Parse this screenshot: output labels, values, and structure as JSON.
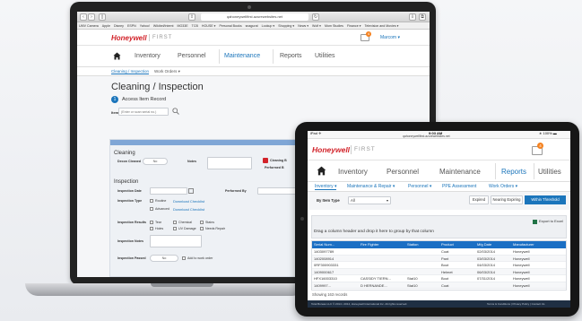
{
  "laptop": {
    "browser": {
      "url": "qahoneywellfirst.azurewebsites.net",
      "bookmarks": [
        "UMV Camera",
        "Apple",
        "Disney",
        "ESPN",
        "Yahoo!",
        "Wikibel/Intemt",
        "MO33E",
        "TCB",
        "HOUSE ▾",
        "Personal Books",
        "snagurat",
        "Lookup ▾",
        "Shopping ▾",
        "News ▾",
        "Wolf ▾",
        "Mom Studies",
        "Finance ▾",
        "Television and Movies ▾"
      ]
    },
    "header": {
      "logo": "Honeywell",
      "product": "FIRST",
      "user": "Marcom ▾",
      "badge": "4"
    },
    "nav": {
      "tabs": [
        "Inventory",
        "Personnel",
        "Maintenance",
        "Reports",
        "Utilities"
      ],
      "active_tab": "Maintenance",
      "subtabs": [
        "Cleaning / Inspection",
        "Work Orders ▾"
      ]
    },
    "page": {
      "title": "Cleaning / Inspection",
      "step_number": "1",
      "step_label": "Access Item Record",
      "item_label": "Item",
      "item_placeholder": "(Enter or scan serial no.)",
      "panel_header": "Cleaning / Inspection Inputs",
      "cleaning": {
        "heading": "Cleaning",
        "decon_label": "Decon Cleaned",
        "decon_value": "No",
        "notes_label": "Notes",
        "cleaning_cert_label": "Cleaning B",
        "performed_label": "Performed B"
      },
      "inspection": {
        "heading": "Inspection",
        "date_label": "Inspection Date",
        "performed_label": "Performed By",
        "type_label": "Inspection Type",
        "type_options": [
          "Routine",
          "Advanced"
        ],
        "checklist_link": "Download Checklist",
        "results_label": "Inspection Results",
        "result_options": [
          "Tear",
          "Holes",
          "Chemical",
          "UV Damage",
          "Stains",
          "Needs Repair"
        ],
        "notes_label": "Inspection Notes",
        "passed_label": "Inspection Passed",
        "passed_value": "No",
        "add_work_order": "Add to work order"
      }
    }
  },
  "tablet": {
    "status": {
      "carrier": "iPad ✈",
      "time": "9:03 AM",
      "battery": "∗ 100% ▬",
      "url": "qahoneywellfirst.azurewebsites.net"
    },
    "header": {
      "logo": "Honeywell",
      "product": "FIRST",
      "badge": "4"
    },
    "nav": {
      "tabs": [
        "Inventory",
        "Personnel",
        "Maintenance",
        "Reports",
        "Utilities"
      ],
      "active_tab": "Reports",
      "subtabs": [
        "Inventory ▾",
        "Maintenance & Repair ▾",
        "Personnel ▾",
        "PPE Assessment",
        "Work Orders ▾"
      ]
    },
    "filters": {
      "item_type_label": "By Item Type",
      "item_type_value": "All",
      "buttons": [
        "Expired",
        "Nearing Expiring",
        "Within Threshold"
      ],
      "active_button": "Within Threshold"
    },
    "grid": {
      "group_hint": "Drag a column header and drop it here to group by that column",
      "export_label": "Export to Excel",
      "columns": [
        "Serial Num...",
        "Fire Fighter",
        "Station",
        "Product",
        "Mfg Date",
        "Manufacturer"
      ],
      "rows": [
        [
          "1403097789",
          "",
          "",
          "Coat",
          "02/03/2014",
          "Honeywell"
        ],
        [
          "1402008914",
          "",
          "",
          "Pant",
          "03/03/2014",
          "Honeywell"
        ],
        [
          "0RF300903331",
          "",
          "",
          "Boot",
          "04/03/2014",
          "Honeywell"
        ],
        [
          "1409000617",
          "",
          "",
          "Helmet",
          "06/03/2014",
          "Honeywell"
        ],
        [
          "HFX16003310",
          "CASSIDY TIERN...",
          "Stat10",
          "Boot",
          "07/31/2014",
          "Honeywell"
        ],
        [
          "1409997...",
          "D HERNANDE...",
          "Stat10",
          "Coat",
          "",
          "Honeywell"
        ]
      ],
      "footer": "Showing 163 records"
    },
    "footer": {
      "left": "Total Bureau LLC © 2014 • 2014, Honeywell International Inc. All rights reserved.",
      "right": "Terms & Conditions | Privacy Policy | Contact Us"
    }
  },
  "colors": {
    "brand_red": "#d2232a",
    "accent_blue": "#1b75bb",
    "panel_header_blue": "#7fa6d6",
    "grid_header_blue": "#1b6fc4"
  }
}
